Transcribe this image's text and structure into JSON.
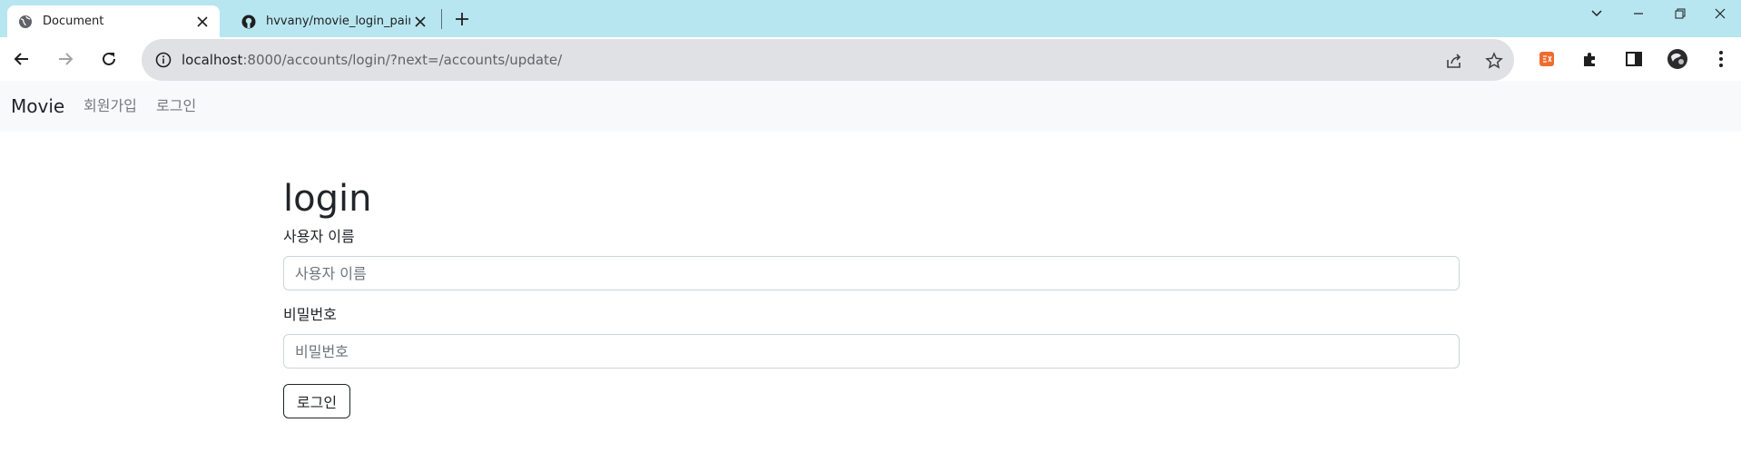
{
  "browser": {
    "tabs": [
      {
        "title": "Document",
        "favicon": "globe-icon",
        "active": true
      },
      {
        "title": "hvvany/movie_login_pair",
        "favicon": "github-icon",
        "active": false
      }
    ],
    "address": {
      "host": "localhost",
      "path": ":8000/accounts/login/?next=/accounts/update/"
    }
  },
  "navbar": {
    "brand": "Movie",
    "links": [
      {
        "label": "회원가입"
      },
      {
        "label": "로그인"
      }
    ]
  },
  "form": {
    "title": "login",
    "username": {
      "label": "사용자 이름",
      "placeholder": "사용자 이름",
      "value": ""
    },
    "password": {
      "label": "비밀번호",
      "placeholder": "비밀번호",
      "value": ""
    },
    "submit_label": "로그인"
  },
  "colors": {
    "tabstrip": "#b7e6f1",
    "navbar_bg": "#f8f9fa",
    "nav_link": "#747a80",
    "text": "#212529"
  }
}
